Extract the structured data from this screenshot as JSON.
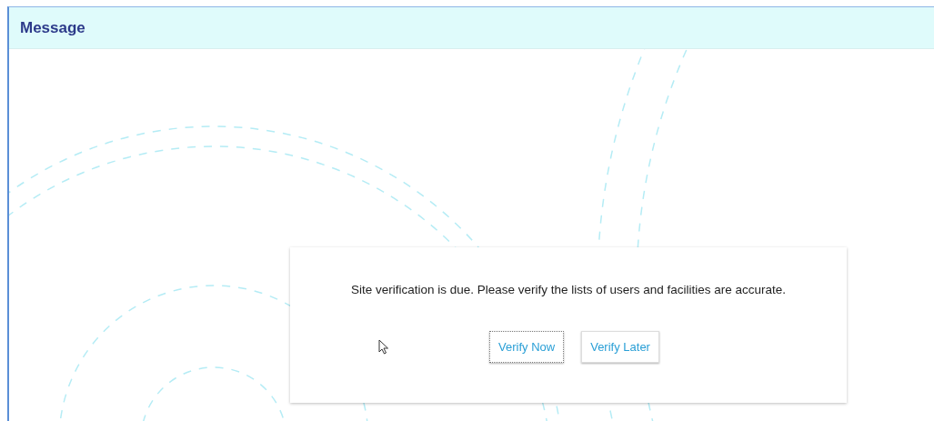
{
  "window": {
    "title": "Message"
  },
  "message": {
    "text": "Site verification is due. Please verify the lists of users and facilities are accurate."
  },
  "buttons": [
    {
      "label": "Verify Now",
      "focused": true
    },
    {
      "label": "Verify Later",
      "focused": false
    }
  ]
}
